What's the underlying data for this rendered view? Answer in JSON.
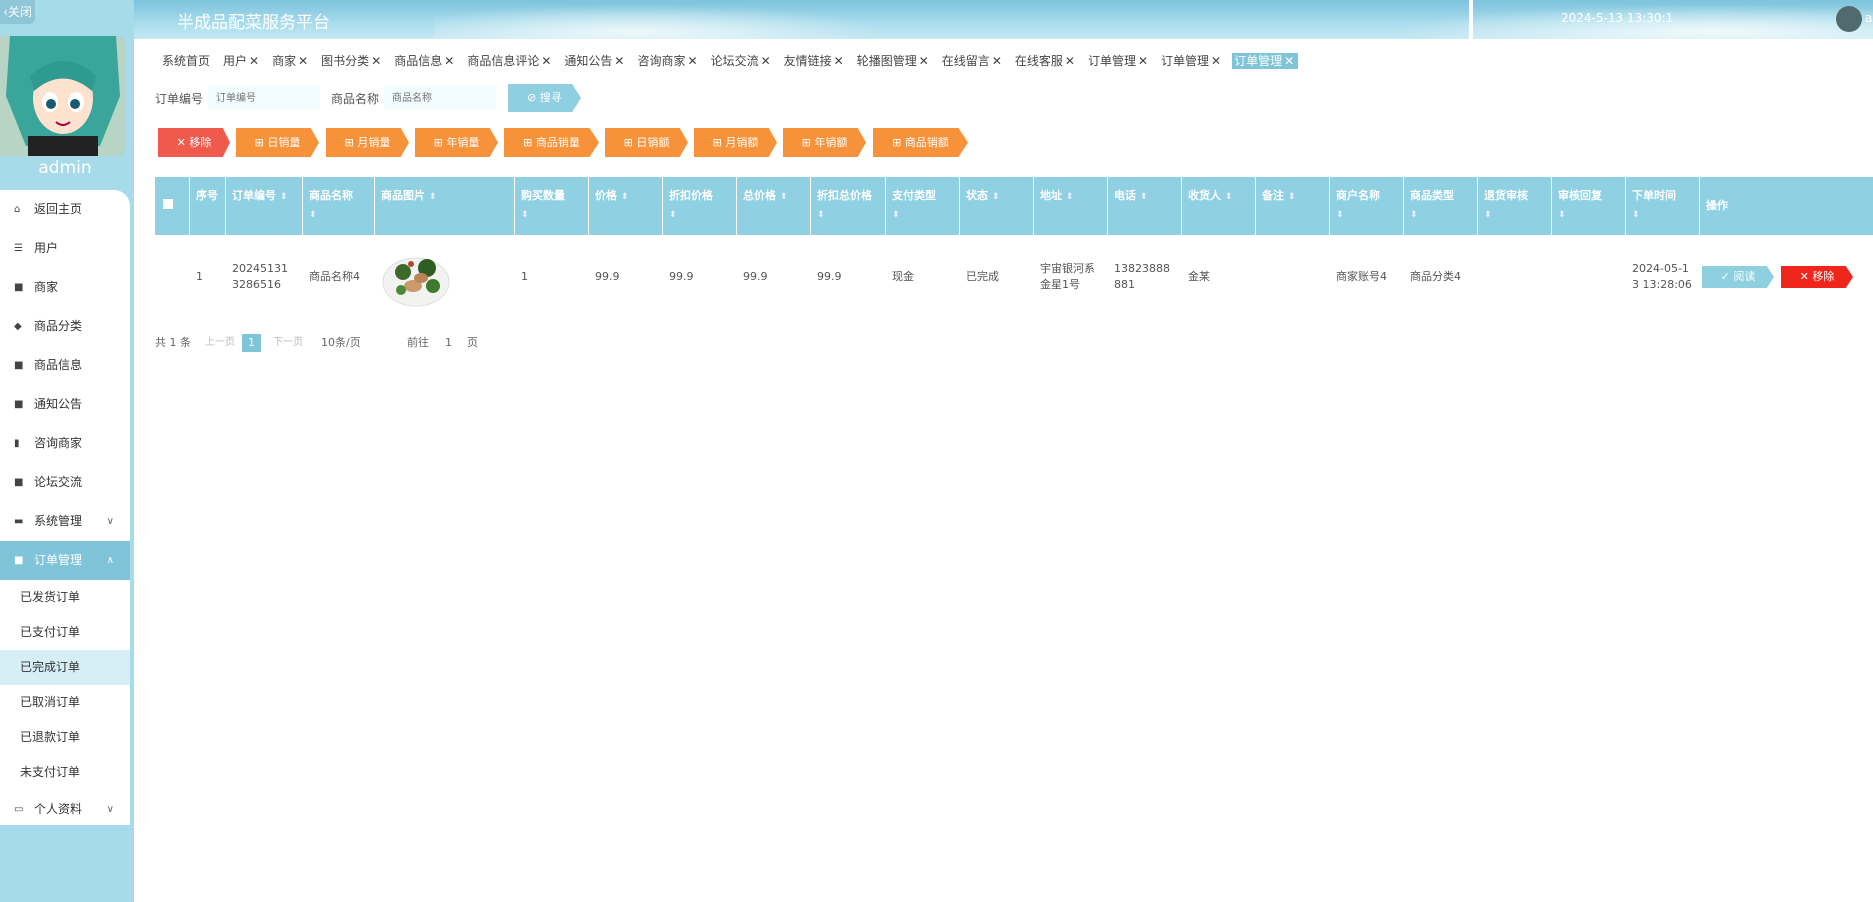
{
  "sidebar": {
    "close_label": "关闭",
    "admin_name": "admin",
    "menu": [
      {
        "label": "返回主页",
        "icon": "home-icon"
      },
      {
        "label": "用户",
        "icon": "sliders-icon"
      },
      {
        "label": "商家",
        "icon": "grid-icon"
      },
      {
        "label": "商品分类",
        "icon": "category-icon"
      },
      {
        "label": "商品信息",
        "icon": "grid-icon"
      },
      {
        "label": "通知公告",
        "icon": "grid-icon"
      },
      {
        "label": "咨询商家",
        "icon": "bar-chart-icon"
      },
      {
        "label": "论坛交流",
        "icon": "grid-icon"
      },
      {
        "label": "系统管理",
        "icon": "monitor-icon"
      },
      {
        "label": "订单管理",
        "icon": "grid-icon"
      },
      {
        "label": "个人资料",
        "icon": "profile-icon"
      }
    ],
    "submenu": [
      "已发货订单",
      "已支付订单",
      "已完成订单",
      "已取消订单",
      "已退款订单",
      "未支付订单"
    ]
  },
  "header": {
    "title": "半成品配菜服务平台",
    "datetime": "2024-5-13 13:30:1",
    "user": "ad"
  },
  "tags": [
    "系统首页",
    "用户",
    "商家",
    "图书分类",
    "商品信息",
    "商品信息评论",
    "通知公告",
    "咨询商家",
    "论坛交流",
    "友情链接",
    "轮播图管理",
    "在线留言",
    "在线客服",
    "订单管理",
    "订单管理",
    "订单管理"
  ],
  "search": {
    "order_no_label": "订单编号",
    "order_no_placeholder": "订单编号",
    "product_name_label": "商品名称",
    "product_name_placeholder": "商品名称",
    "search_button": "搜寻"
  },
  "actions": [
    "移除",
    "日销量",
    "月销量",
    "年销量",
    "商品销量",
    "日销额",
    "月销额",
    "年销额",
    "商品销额"
  ],
  "table": {
    "headers": [
      "序号",
      "订单编号",
      "商品名称",
      "商品图片",
      "购买数量",
      "价格",
      "折扣价格",
      "总价格",
      "折扣总价格",
      "支付类型",
      "状态",
      "地址",
      "电话",
      "收货人",
      "备注",
      "商户名称",
      "商品类型",
      "退货审核",
      "审核回复",
      "下单时间",
      "操作"
    ],
    "rows": [
      {
        "index": "1",
        "order_no": "202451313286516",
        "product_name": "商品名称4",
        "quantity": "1",
        "price": "99.9",
        "discount_price": "99.9",
        "total_price": "99.9",
        "discount_total": "99.9",
        "pay_type": "现金",
        "status": "已完成",
        "address": "宇宙银河系金星1号",
        "phone": "13823888881",
        "receiver": "金某",
        "remark": "",
        "merchant": "商家账号4",
        "category": "商品分类4",
        "return_audit": "",
        "audit_reply": "",
        "order_time": "2024-05-13 13:28:06",
        "btn_read": "阅读",
        "btn_remove": "移除"
      }
    ]
  },
  "pager": {
    "total": "共 1 条",
    "prev": "上一页",
    "current": "1",
    "next": "下一页",
    "size": "10条/页",
    "goto": "前往",
    "goto_page": "1",
    "page_unit": "页"
  },
  "colors": {
    "accent": "#7fc4d8",
    "header_blue": "#8fd0e2",
    "danger": "#ef5a4d",
    "warning": "#f6923a"
  }
}
